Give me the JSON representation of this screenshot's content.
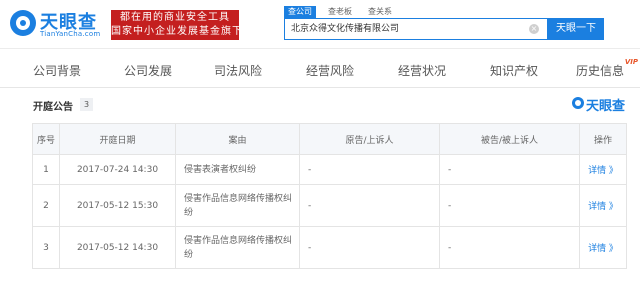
{
  "header": {
    "logo": {
      "name": "天眼查",
      "domain": "TianYanCha.com"
    },
    "slogan": {
      "line1": "都在用的商业安全工具",
      "line2": "国家中小企业发展基金旗下"
    },
    "search_tabs": [
      "查公司",
      "查老板",
      "查关系"
    ],
    "search_value": "北京众得文化传播有限公司",
    "search_button": "天眼一下"
  },
  "nav": {
    "items": [
      "公司背景",
      "公司发展",
      "司法风险",
      "经营风险",
      "经营状况",
      "知识产权",
      "历史信息"
    ],
    "vip_badge": "VIP"
  },
  "section": {
    "title": "开庭公告",
    "count": "3",
    "brand": "天眼查"
  },
  "table": {
    "headers": [
      "序号",
      "开庭日期",
      "案由",
      "原告/上诉人",
      "被告/被上诉人",
      "操作"
    ],
    "rows": [
      {
        "index": "1",
        "date": "2017-07-24 14:30",
        "cause": "侵害表演者权纠纷",
        "plaintiff": "-",
        "defendant": "-",
        "action": "详情 》"
      },
      {
        "index": "2",
        "date": "2017-05-12 15:30",
        "cause": "侵害作品信息网络传播权纠纷",
        "plaintiff": "-",
        "defendant": "-",
        "action": "详情 》"
      },
      {
        "index": "3",
        "date": "2017-05-12 14:30",
        "cause": "侵害作品信息网络传播权纠纷",
        "plaintiff": "-",
        "defendant": "-",
        "action": "详情 》"
      }
    ]
  },
  "colors": {
    "brand_blue": "#1b7fe0",
    "slogan_red": "#c41f1f",
    "vip_orange": "#e8572b"
  },
  "icons": [
    "tianyancha-logo-icon",
    "clear-icon",
    "tianyancha-brand-icon"
  ]
}
